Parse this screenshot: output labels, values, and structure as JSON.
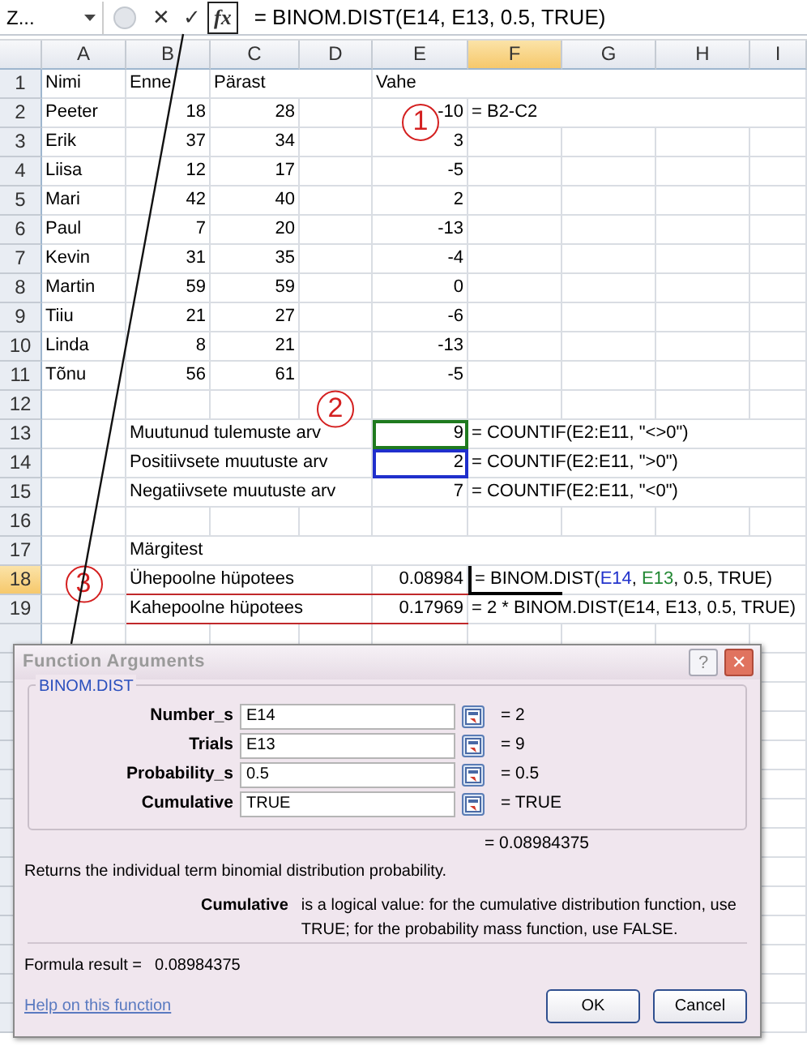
{
  "formula_bar": {
    "name_box": "Z...",
    "buttons": [
      {
        "kind": "cancel",
        "label": "✕"
      },
      {
        "kind": "enter",
        "label": "✓"
      },
      {
        "kind": "function",
        "label": "fx"
      }
    ],
    "formula": "= BINOM.DIST(E14, E13, 0.5, TRUE)"
  },
  "columns": [
    {
      "label": "A",
      "selected": false
    },
    {
      "label": "B",
      "selected": false
    },
    {
      "label": "C",
      "selected": false
    },
    {
      "label": "D",
      "selected": false
    },
    {
      "label": "E",
      "selected": false
    },
    {
      "label": "F",
      "selected": true
    },
    {
      "label": "G",
      "selected": false
    },
    {
      "label": "H",
      "selected": false
    },
    {
      "label": "I",
      "selected": false
    }
  ],
  "rows": [
    {
      "number": "1",
      "selected": false,
      "cells": {
        "A": {
          "kind": "text",
          "text": "Nimi"
        },
        "B": {
          "kind": "text",
          "text": "Enne"
        },
        "C": {
          "kind": "text",
          "text": "Pärast"
        },
        "E": {
          "kind": "text",
          "text": "Vahe"
        }
      }
    },
    {
      "number": "2",
      "selected": false,
      "cells": {
        "A": {
          "kind": "text",
          "text": "Peeter"
        },
        "B": {
          "kind": "number",
          "text": "18"
        },
        "C": {
          "kind": "number",
          "text": "28"
        },
        "E": {
          "kind": "number",
          "text": "-10",
          "marker": "1"
        },
        "F": {
          "kind": "text",
          "text": "= B2-C2"
        }
      }
    },
    {
      "number": "3",
      "selected": false,
      "cells": {
        "A": {
          "kind": "text",
          "text": "Erik"
        },
        "B": {
          "kind": "number",
          "text": "37"
        },
        "C": {
          "kind": "number",
          "text": "34"
        },
        "E": {
          "kind": "number",
          "text": "3"
        }
      }
    },
    {
      "number": "4",
      "selected": false,
      "cells": {
        "A": {
          "kind": "text",
          "text": "Liisa"
        },
        "B": {
          "kind": "number",
          "text": "12"
        },
        "C": {
          "kind": "number",
          "text": "17"
        },
        "E": {
          "kind": "number",
          "text": "-5"
        }
      }
    },
    {
      "number": "5",
      "selected": false,
      "cells": {
        "A": {
          "kind": "text",
          "text": "Mari"
        },
        "B": {
          "kind": "number",
          "text": "42"
        },
        "C": {
          "kind": "number",
          "text": "40"
        },
        "E": {
          "kind": "number",
          "text": "2"
        }
      }
    },
    {
      "number": "6",
      "selected": false,
      "cells": {
        "A": {
          "kind": "text",
          "text": "Paul"
        },
        "B": {
          "kind": "number",
          "text": "7"
        },
        "C": {
          "kind": "number",
          "text": "20"
        },
        "E": {
          "kind": "number",
          "text": "-13"
        }
      }
    },
    {
      "number": "7",
      "selected": false,
      "cells": {
        "A": {
          "kind": "text",
          "text": "Kevin"
        },
        "B": {
          "kind": "number",
          "text": "31"
        },
        "C": {
          "kind": "number",
          "text": "35"
        },
        "E": {
          "kind": "number",
          "text": "-4"
        }
      }
    },
    {
      "number": "8",
      "selected": false,
      "cells": {
        "A": {
          "kind": "text",
          "text": "Martin"
        },
        "B": {
          "kind": "number",
          "text": "59"
        },
        "C": {
          "kind": "number",
          "text": "59"
        },
        "E": {
          "kind": "number",
          "text": "0"
        }
      }
    },
    {
      "number": "9",
      "selected": false,
      "cells": {
        "A": {
          "kind": "text",
          "text": "Tiiu"
        },
        "B": {
          "kind": "number",
          "text": "21"
        },
        "C": {
          "kind": "number",
          "text": "27"
        },
        "E": {
          "kind": "number",
          "text": "-6"
        }
      }
    },
    {
      "number": "10",
      "selected": false,
      "cells": {
        "A": {
          "kind": "text",
          "text": "Linda"
        },
        "B": {
          "kind": "number",
          "text": "8"
        },
        "C": {
          "kind": "number",
          "text": "21"
        },
        "E": {
          "kind": "number",
          "text": "-13"
        }
      }
    },
    {
      "number": "11",
      "selected": false,
      "cells": {
        "A": {
          "kind": "text",
          "text": "Tõnu"
        },
        "B": {
          "kind": "number",
          "text": "56"
        },
        "C": {
          "kind": "number",
          "text": "61"
        },
        "E": {
          "kind": "number",
          "text": "-5"
        }
      }
    },
    {
      "number": "12",
      "selected": false,
      "cells": {
        "D": {
          "kind": "empty",
          "marker": "2"
        }
      }
    },
    {
      "number": "13",
      "selected": false,
      "cells": {
        "B": {
          "kind": "text",
          "text": "Muutunud tulemuste arv"
        },
        "E": {
          "kind": "number",
          "text": "9",
          "color": "#1f7a1f"
        },
        "F": {
          "kind": "text",
          "text": "= COUNTIF(E2:E11, \"<>0\")"
        }
      }
    },
    {
      "number": "14",
      "selected": false,
      "cells": {
        "B": {
          "kind": "text",
          "text": "Positiivsete muutuste arv"
        },
        "E": {
          "kind": "number",
          "text": "2",
          "color": "#1f2fcc"
        },
        "F": {
          "kind": "text",
          "text": "= COUNTIF(E2:E11, \">0\")"
        }
      }
    },
    {
      "number": "15",
      "selected": false,
      "cells": {
        "B": {
          "kind": "text",
          "text": "Negatiivsete muutuste arv"
        },
        "E": {
          "kind": "number",
          "text": "7"
        },
        "F": {
          "kind": "text",
          "text": "= COUNTIF(E2:E11, \"<0\")"
        }
      }
    },
    {
      "number": "16",
      "selected": false,
      "cells": {}
    },
    {
      "number": "17",
      "selected": false,
      "cells": {
        "B": {
          "kind": "text",
          "text": "Märgitest"
        }
      }
    },
    {
      "number": "18",
      "selected": true,
      "underlined": true,
      "cells": {
        "A": {
          "kind": "empty",
          "marker": "3"
        },
        "B": {
          "kind": "text",
          "text": "Ühepoolne hüpotees"
        },
        "E": {
          "kind": "number",
          "text": "0.08984"
        },
        "F": {
          "kind": "parts",
          "active": true,
          "parts": [
            {
              "text": "= BINOM.DIST("
            },
            {
              "text": "E14",
              "color": "#2233cc"
            },
            {
              "text": ", "
            },
            {
              "text": "E13",
              "color": "#228833"
            },
            {
              "text": ", 0.5, TRUE)"
            }
          ]
        }
      }
    },
    {
      "number": "19",
      "selected": false,
      "underlined": true,
      "cells": {
        "B": {
          "kind": "text",
          "text": "Kahepoolne hüpotees"
        },
        "E": {
          "kind": "number",
          "text": "0.17969"
        },
        "F": {
          "kind": "text",
          "text": "= 2 * BINOM.DIST(E14, E13, 0.5, TRUE)"
        }
      }
    }
  ],
  "dialog": {
    "title": "Function Arguments",
    "title_buttons": [
      {
        "kind": "help",
        "label": "?"
      },
      {
        "kind": "close",
        "label": "✕"
      }
    ],
    "function_name": "BINOM.DIST",
    "arguments": [
      {
        "label": "Number_s",
        "value": "E14",
        "result": "= 2"
      },
      {
        "label": "Trials",
        "value": "E13",
        "result": "= 9"
      },
      {
        "label": "Probability_s",
        "value": "0.5",
        "result": "= 0.5"
      },
      {
        "label": "Cumulative",
        "value": "TRUE",
        "result": "= TRUE"
      }
    ],
    "result": "= 0.08984375",
    "description": "Returns the individual term binomial distribution probability.",
    "argument_help": {
      "label": "Cumulative",
      "text": "is a logical value: for the cumulative distribution function, use TRUE; for the probability mass function, use FALSE."
    },
    "formula_result": {
      "label": "Formula result =",
      "value": "0.08984375"
    },
    "help_link": "Help on this function",
    "buttons": [
      "OK",
      "Cancel"
    ]
  }
}
